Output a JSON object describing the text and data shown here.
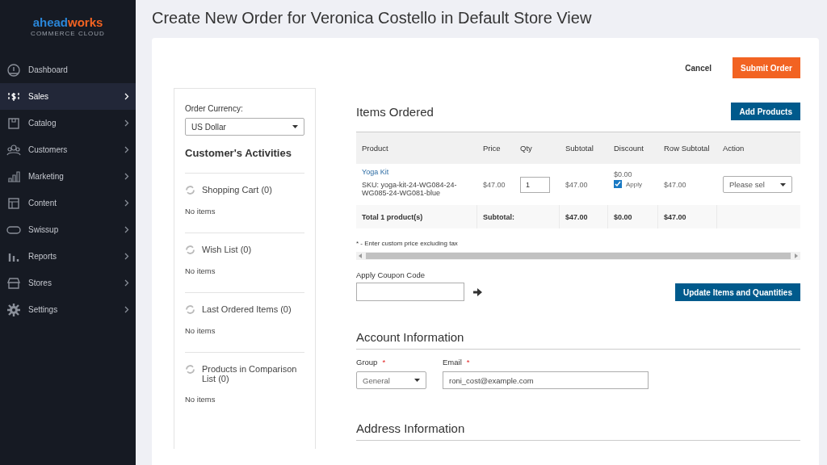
{
  "logo": {
    "part_1": "ahead",
    "part_2": "works",
    "tagline": "COMMERCE CLOUD"
  },
  "sidebar": {
    "items": [
      {
        "label": "Dashboard",
        "selected": false,
        "expandable": false
      },
      {
        "label": "Sales",
        "selected": true,
        "expandable": true
      },
      {
        "label": "Catalog",
        "selected": false,
        "expandable": true
      },
      {
        "label": "Customers",
        "selected": false,
        "expandable": true
      },
      {
        "label": "Marketing",
        "selected": false,
        "expandable": true
      },
      {
        "label": "Content",
        "selected": false,
        "expandable": true
      },
      {
        "label": "Swissup",
        "selected": false,
        "expandable": true
      },
      {
        "label": "Reports",
        "selected": false,
        "expandable": true
      },
      {
        "label": "Stores",
        "selected": false,
        "expandable": true
      },
      {
        "label": "Settings",
        "selected": false,
        "expandable": true
      }
    ]
  },
  "page_title": "Create New Order for Veronica Costello in Default Store View",
  "actions": [
    {
      "label": "Cancel",
      "kind": "link"
    },
    {
      "label": "Submit Order",
      "kind": "primary"
    }
  ],
  "currency": {
    "label": "Order Currency:",
    "value": "US Dollar"
  },
  "activities": {
    "title": "Customer's Activities",
    "sections": [
      {
        "title": "Shopping Cart (0)",
        "empty_text": "No items"
      },
      {
        "title": "Wish List (0)",
        "empty_text": "No items"
      },
      {
        "title": "Last Ordered Items (0)",
        "empty_text": "No items"
      },
      {
        "title": "Products in Comparison List (0)",
        "empty_text": "No items"
      }
    ]
  },
  "items_ordered": {
    "title": "Items Ordered",
    "add_button": "Add Products",
    "columns": [
      "Product",
      "Price",
      "Qty",
      "Subtotal",
      "Discount",
      "Row Subtotal",
      "Action"
    ],
    "rows": [
      {
        "product": "Yoga Kit",
        "sku": "SKU: yoga-kit-24-WG084-24-WG085-24-WG081-blue",
        "price": "$47.00",
        "qty": "1",
        "subtotal": "$47.00",
        "discount": "$0.00",
        "apply_label": "Apply",
        "apply_checked": true,
        "row_subtotal": "$47.00",
        "action_placeholder": "Please sel"
      }
    ],
    "totals": {
      "label": "Total 1 product(s)",
      "subtotal_label": "Subtotal:",
      "subtotal": "$47.00",
      "discount": "$0.00",
      "row_subtotal": "$47.00"
    },
    "note": "* - Enter custom price excluding tax",
    "coupon_label": "Apply Coupon Code",
    "update_button": "Update Items and Quantities"
  },
  "account": {
    "title": "Account Information",
    "fields": [
      {
        "label": "Group",
        "required_mark": "*",
        "value": "General",
        "kind": "select"
      },
      {
        "label": "Email",
        "required_mark": "*",
        "value": "roni_cost@example.com",
        "kind": "text"
      }
    ]
  },
  "address": {
    "title": "Address Information"
  }
}
